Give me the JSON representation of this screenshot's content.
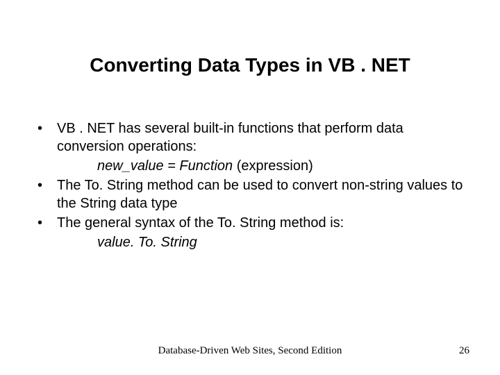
{
  "title": "Converting Data Types in VB . NET",
  "bullets": [
    {
      "text": "VB . NET has several built-in functions that perform data conversion operations:",
      "sub": {
        "prefix": "new_value = Function ",
        "paren": "(expression)"
      }
    },
    {
      "text": "The To. String method can be used to convert non-string values to the String data type"
    },
    {
      "text": "The general syntax of the To. String method is:",
      "sub": {
        "ital": "value. To. String"
      }
    }
  ],
  "footer": {
    "center": "Database-Driven Web Sites, Second Edition",
    "page": "26"
  },
  "bullet_glyph": "•"
}
